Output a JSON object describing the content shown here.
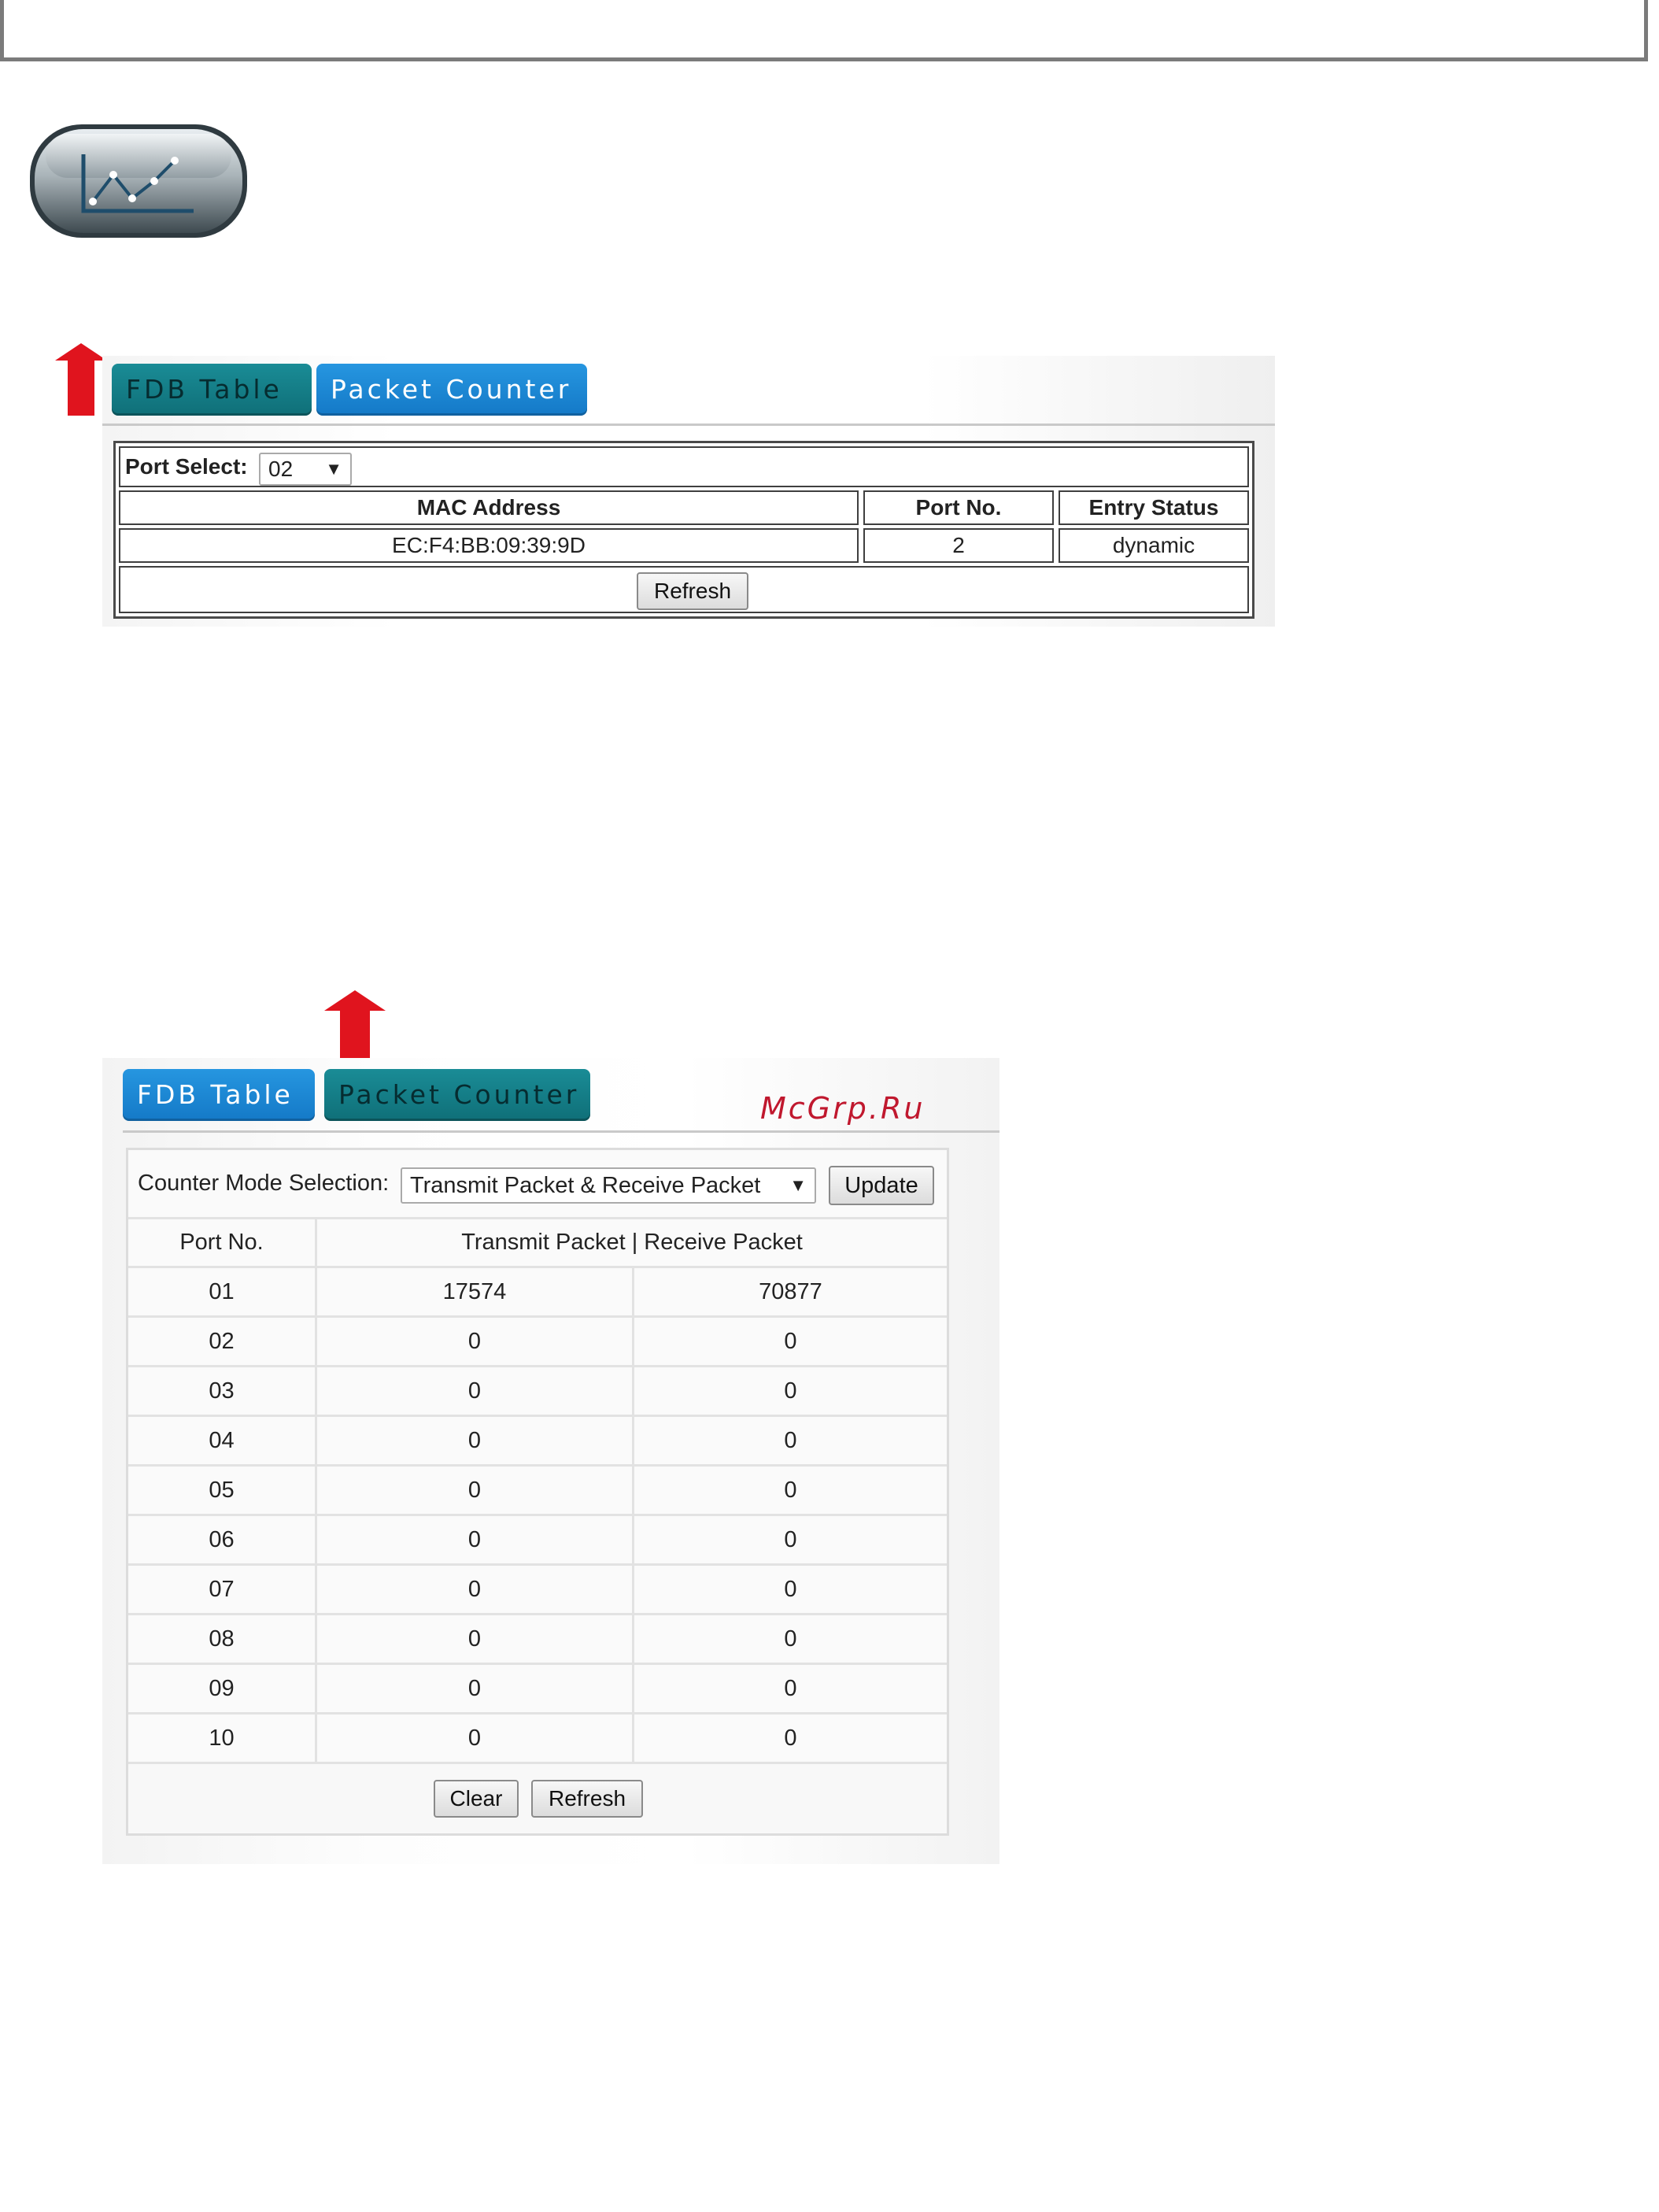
{
  "panel_fdb": {
    "tabs": [
      {
        "label": "FDB Table",
        "active": true
      },
      {
        "label": "Packet Counter",
        "active": false
      }
    ],
    "port_select_label": "Port Select:",
    "port_select_value": "02",
    "columns": [
      "MAC Address",
      "Port No.",
      "Entry Status"
    ],
    "rows": [
      {
        "mac": "EC:F4:BB:09:39:9D",
        "port": "2",
        "status": "dynamic"
      }
    ],
    "refresh_label": "Refresh"
  },
  "panel_pc": {
    "tabs": [
      {
        "label": "FDB Table",
        "active": false
      },
      {
        "label": "Packet Counter",
        "active": true
      }
    ],
    "watermark": "McGrp.Ru",
    "mode_label": "Counter Mode Selection:",
    "mode_value": "Transmit Packet & Receive Packet",
    "update_label": "Update",
    "header_port": "Port No.",
    "header_packets": "Transmit Packet | Receive Packet",
    "rows": [
      {
        "port": "01",
        "tx": "17574",
        "rx": "70877"
      },
      {
        "port": "02",
        "tx": "0",
        "rx": "0"
      },
      {
        "port": "03",
        "tx": "0",
        "rx": "0"
      },
      {
        "port": "04",
        "tx": "0",
        "rx": "0"
      },
      {
        "port": "05",
        "tx": "0",
        "rx": "0"
      },
      {
        "port": "06",
        "tx": "0",
        "rx": "0"
      },
      {
        "port": "07",
        "tx": "0",
        "rx": "0"
      },
      {
        "port": "08",
        "tx": "0",
        "rx": "0"
      },
      {
        "port": "09",
        "tx": "0",
        "rx": "0"
      },
      {
        "port": "10",
        "tx": "0",
        "rx": "0"
      }
    ],
    "clear_label": "Clear",
    "refresh_label": "Refresh"
  },
  "colors": {
    "tab_active": "#0f6f78",
    "tab_inactive": "#1479c7",
    "arrow_red": "#e0141e",
    "watermark": "#c0182e"
  },
  "icons": [
    "line-chart-icon",
    "up-arrow-icon"
  ]
}
